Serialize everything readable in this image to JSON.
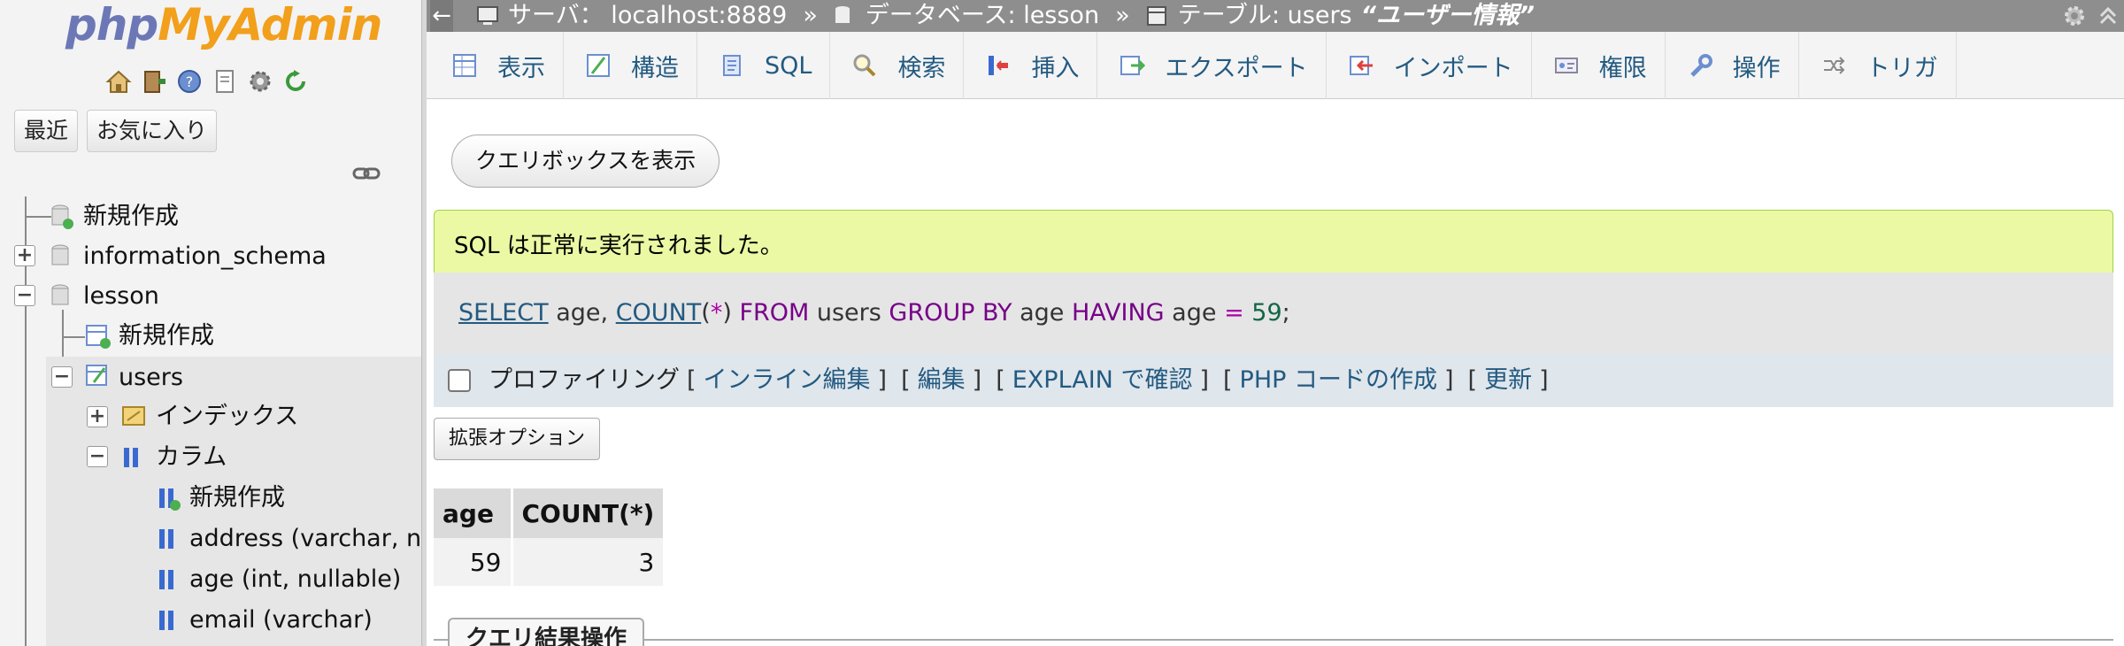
{
  "nav": {
    "logo_php": "php",
    "logo_myadmin": "MyAdmin",
    "icons": [
      "home-icon",
      "exit-icon",
      "help-icon",
      "docs-icon",
      "settings-icon",
      "reload-icon"
    ],
    "recent_label": "最近",
    "favorites_label": "お気に入り",
    "tree": {
      "new_root": "新規作成",
      "db_information_schema": "information_schema",
      "db_lesson": "lesson",
      "lesson_new": "新規作成",
      "table_users": "users",
      "indexes": "インデックス",
      "columns": "カラム",
      "columns_new": "新規作成",
      "col_address": "address (varchar, nu",
      "col_age": "age (int, nullable)",
      "col_email": "email (varchar)"
    }
  },
  "breadcrumb": {
    "server": "サーバ： localhost:8889",
    "database": "データベース: lesson",
    "table": "テーブル: users",
    "table_comment": "“ユーザー情報”",
    "separator": "»"
  },
  "tabs": [
    {
      "label": "表示",
      "icon": "browse-icon"
    },
    {
      "label": "構造",
      "icon": "structure-icon"
    },
    {
      "label": "SQL",
      "icon": "sql-icon"
    },
    {
      "label": "検索",
      "icon": "search-icon"
    },
    {
      "label": "挿入",
      "icon": "insert-icon"
    },
    {
      "label": "エクスポート",
      "icon": "export-icon"
    },
    {
      "label": "インポート",
      "icon": "import-icon"
    },
    {
      "label": "権限",
      "icon": "privileges-icon"
    },
    {
      "label": "操作",
      "icon": "operations-icon"
    },
    {
      "label": "トリガ",
      "icon": "triggers-icon"
    }
  ],
  "main": {
    "show_query_box": "クエリボックスを表示",
    "success_message": "SQL は正常に実行されました。",
    "sql": {
      "select": "SELECT",
      "p1": " age, ",
      "count": "COUNT",
      "lparen": "(",
      "star": "*",
      "rparen": ")",
      "from": " FROM",
      "p2": " users ",
      "group_by": "GROUP BY",
      "p3": " age ",
      "having": "HAVING",
      "p4": " age ",
      "eq": "=",
      "num": " 59",
      "semi": ";"
    },
    "actions": {
      "profiling": "プロファイリング",
      "inline_edit": "インライン編集",
      "edit": "編集",
      "explain": "EXPLAIN で確認",
      "php_code": "PHP コードの作成",
      "refresh": "更新",
      "open": "[",
      "close": "]"
    },
    "extended_options": "拡張オプション",
    "result": {
      "columns": [
        "age",
        "COUNT(*)"
      ],
      "rows": [
        [
          "59",
          "3"
        ]
      ]
    },
    "query_results_ops": "クエリ結果操作"
  }
}
